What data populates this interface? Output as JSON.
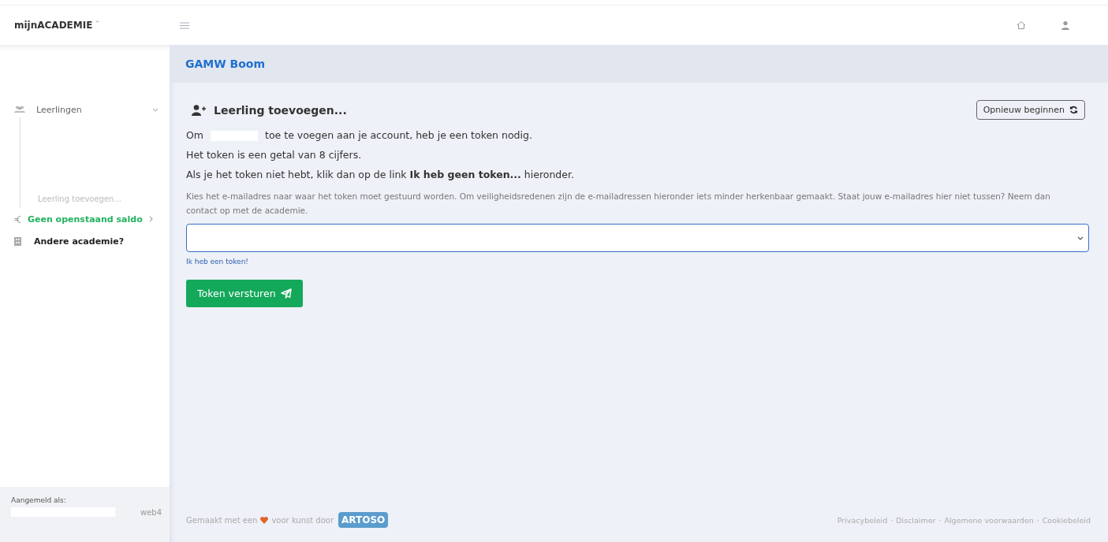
{
  "header": {
    "brand": "mijnACADEMIE",
    "brand_mark": "™"
  },
  "sidebar": {
    "items": [
      {
        "kind": "group",
        "label": "Leerlingen",
        "expanded": true,
        "children": [
          {
            "label": "Leerling toevoegen...",
            "selected": false
          }
        ]
      },
      {
        "kind": "balance",
        "label": "Geen openstaand saldo"
      },
      {
        "kind": "link",
        "label": "Andere academie?"
      }
    ],
    "signed_in_label": "Aangemeld als:",
    "server": "web4"
  },
  "page_title": "GAMW Boom",
  "card": {
    "title": "Leerling toevoegen...",
    "restart_button": "Opnieuw beginnen",
    "intro_before": "Om",
    "intro_after": "toe te voegen aan je account, heb je een token nodig.",
    "paragraphs": [
      "Het token is een getal van 8 cijfers.",
      "Als je het token niet hebt, klik dan op de link **Ik heb geen token...** hieronder."
    ],
    "hint": "Kies het e-mailadres naar waar het token moet gestuurd worden. Om veiligheidsredenen zijn de e-mailadressen hieronder iets minder herkenbaar gemaakt. Staat jouw e-mailadres hier niet tussen? Neem dan contact op met de academie.",
    "have_token_link": "Ik heb een token!",
    "send_button": "Token versturen"
  },
  "footer": {
    "made_before": "Gemaakt met een",
    "made_after": "voor kunst door",
    "brand": "ARTOSO",
    "links": [
      "Privacybeleid",
      "Disclaimer",
      "Algemene voorwaarden",
      "Cookiebeleid"
    ],
    "separator": "·"
  }
}
